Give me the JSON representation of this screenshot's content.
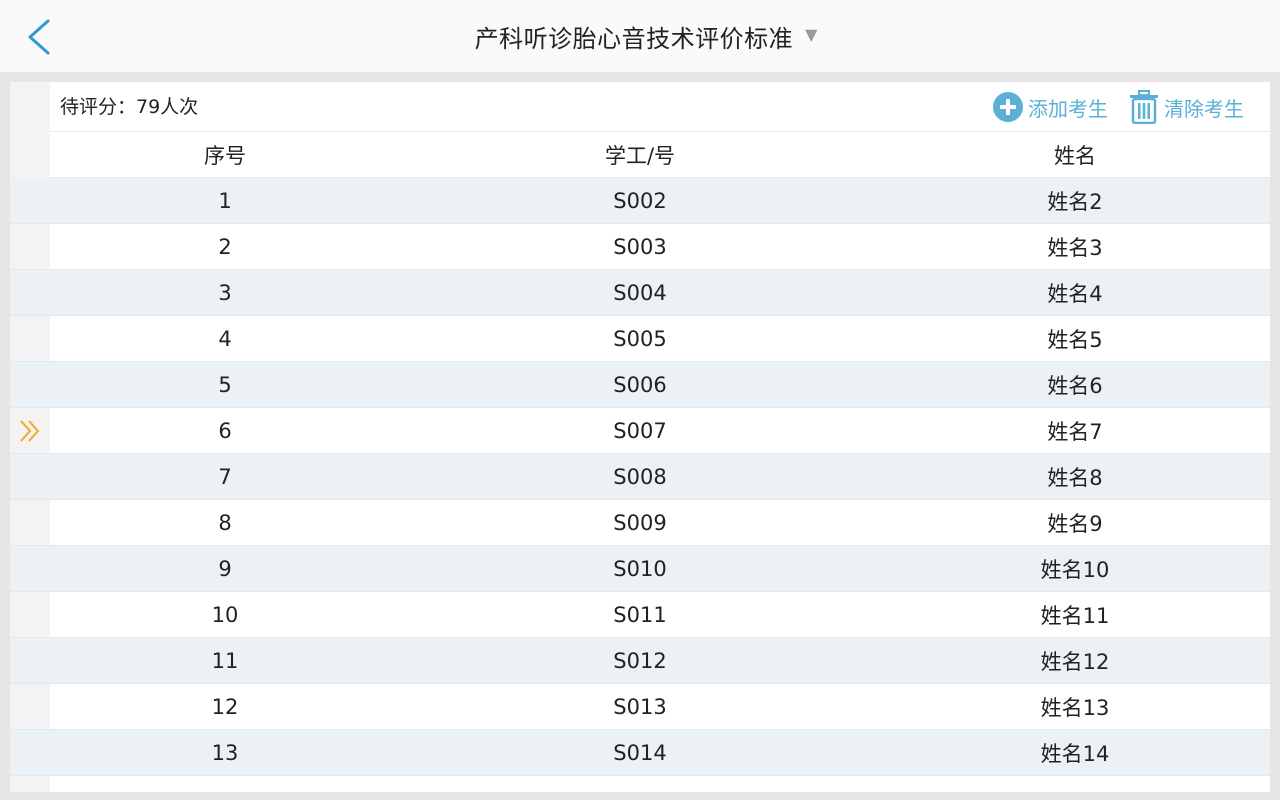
{
  "header": {
    "title": "产科听诊胎心音技术评价标准",
    "dropdown_arrow": "▼"
  },
  "toolbar": {
    "pending_label": "待评分：79人次",
    "add_label": "添加考生",
    "clear_label": "清除考生"
  },
  "table": {
    "columns": [
      "序号",
      "学工/号",
      "姓名"
    ],
    "current_row_index": 5,
    "rows": [
      {
        "no": "1",
        "id": "S002",
        "name": "姓名2"
      },
      {
        "no": "2",
        "id": "S003",
        "name": "姓名3"
      },
      {
        "no": "3",
        "id": "S004",
        "name": "姓名4"
      },
      {
        "no": "4",
        "id": "S005",
        "name": "姓名5"
      },
      {
        "no": "5",
        "id": "S006",
        "name": "姓名6"
      },
      {
        "no": "6",
        "id": "S007",
        "name": "姓名7"
      },
      {
        "no": "7",
        "id": "S008",
        "name": "姓名8"
      },
      {
        "no": "8",
        "id": "S009",
        "name": "姓名9"
      },
      {
        "no": "9",
        "id": "S010",
        "name": "姓名10"
      },
      {
        "no": "10",
        "id": "S011",
        "name": "姓名11"
      },
      {
        "no": "11",
        "id": "S012",
        "name": "姓名12"
      },
      {
        "no": "12",
        "id": "S013",
        "name": "姓名13"
      },
      {
        "no": "13",
        "id": "S014",
        "name": "姓名14"
      }
    ]
  },
  "colors": {
    "accent_blue": "#5ab0d8",
    "back_blue": "#2e9bd6",
    "current_marker": "#f5a623",
    "row_alt": "#ebf1f4"
  },
  "icons": {
    "back": "chevron-left-icon",
    "add": "plus-circle-icon",
    "clear": "trash-icon",
    "current": "double-chevron-right-icon"
  }
}
